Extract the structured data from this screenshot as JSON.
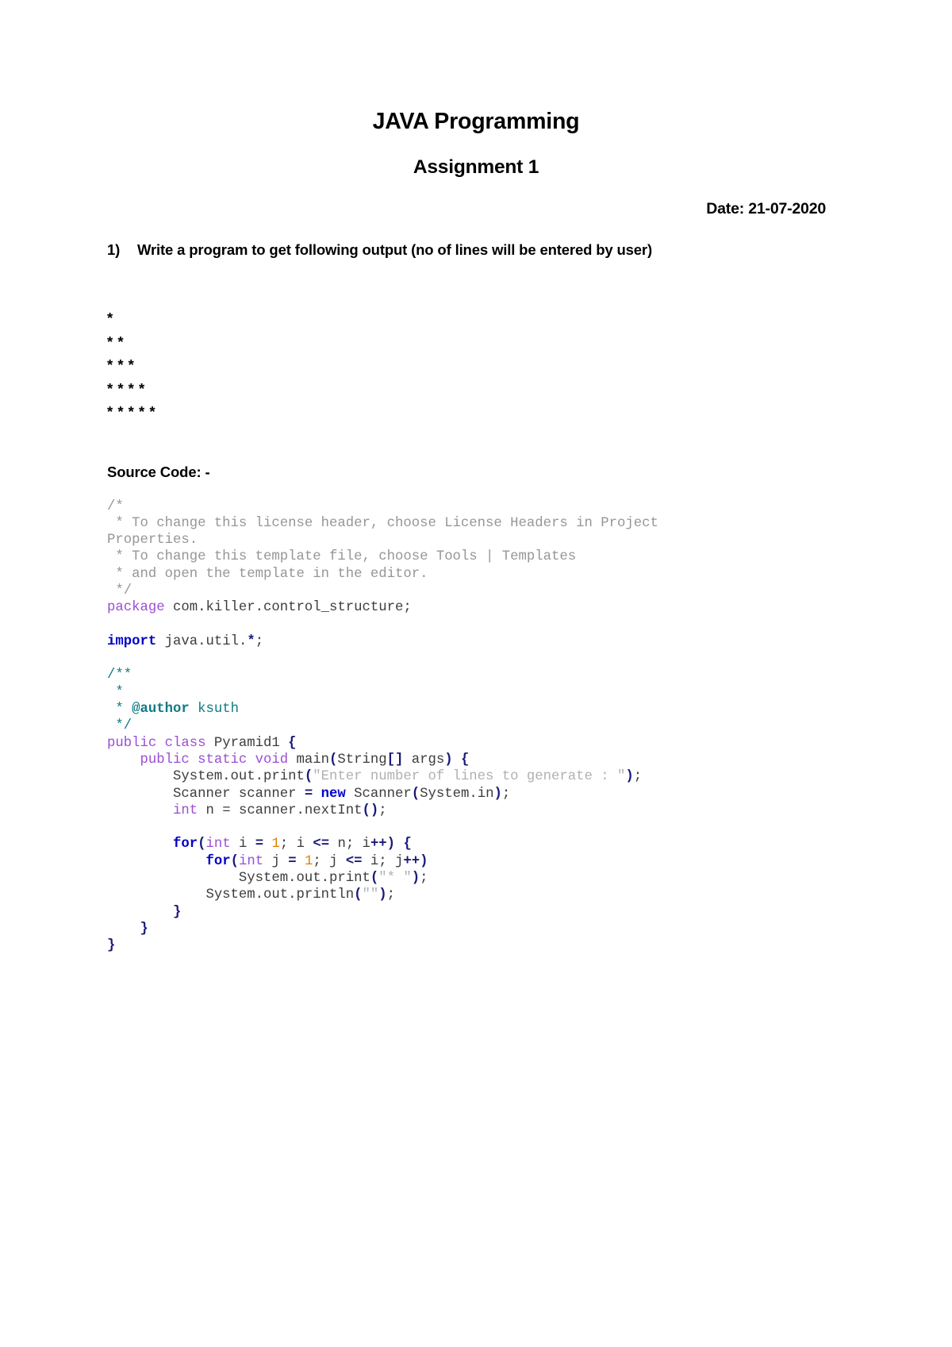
{
  "document": {
    "title": "JAVA Programming",
    "subtitle": "Assignment 1",
    "date_label": "Date: 21-07-2020"
  },
  "question": {
    "number": "1)",
    "text": "Write a program to get following output (no of lines will be entered by user)"
  },
  "pattern_output": {
    "lines": [
      "*",
      "* *",
      "* * *",
      "* * * *",
      "* * * * *"
    ]
  },
  "source_section": {
    "heading": "Source Code: -"
  },
  "code": {
    "language": "java",
    "lines": [
      {
        "tokens": [
          {
            "t": "/*",
            "c": "comment"
          }
        ]
      },
      {
        "tokens": [
          {
            "t": " * To change this license header, choose License Headers in Project",
            "c": "comment"
          }
        ]
      },
      {
        "tokens": [
          {
            "t": "Properties.",
            "c": "comment"
          }
        ]
      },
      {
        "tokens": [
          {
            "t": " * To change this template file, choose Tools | Templates",
            "c": "comment"
          }
        ]
      },
      {
        "tokens": [
          {
            "t": " * and open the template in the editor.",
            "c": "comment"
          }
        ]
      },
      {
        "tokens": [
          {
            "t": " */",
            "c": "comment"
          }
        ]
      },
      {
        "tokens": [
          {
            "t": "package",
            "c": "keyword"
          },
          {
            "t": " com.killer.control_structure;",
            "c": "plain"
          }
        ]
      },
      {
        "tokens": []
      },
      {
        "tokens": [
          {
            "t": "import",
            "c": "kw-blue"
          },
          {
            "t": " java.util.",
            "c": "plain"
          },
          {
            "t": "*",
            "c": "op"
          },
          {
            "t": ";",
            "c": "plain"
          }
        ]
      },
      {
        "tokens": []
      },
      {
        "tokens": [
          {
            "t": "/**",
            "c": "javadoc"
          }
        ]
      },
      {
        "tokens": [
          {
            "t": " *",
            "c": "javadoc"
          }
        ]
      },
      {
        "tokens": [
          {
            "t": " * ",
            "c": "javadoc"
          },
          {
            "t": "@author",
            "c": "javadoc-tag"
          },
          {
            "t": " ksuth",
            "c": "javadoc"
          }
        ]
      },
      {
        "tokens": [
          {
            "t": " */",
            "c": "javadoc"
          }
        ]
      },
      {
        "tokens": [
          {
            "t": "public class",
            "c": "keyword"
          },
          {
            "t": " Pyramid1 ",
            "c": "plain"
          },
          {
            "t": "{",
            "c": "brace"
          }
        ]
      },
      {
        "tokens": [
          {
            "t": "    ",
            "c": "plain"
          },
          {
            "t": "public static void",
            "c": "keyword"
          },
          {
            "t": " main",
            "c": "plain"
          },
          {
            "t": "(",
            "c": "brace"
          },
          {
            "t": "String",
            "c": "plain"
          },
          {
            "t": "[]",
            "c": "brace"
          },
          {
            "t": " args",
            "c": "plain"
          },
          {
            "t": ")",
            "c": "brace"
          },
          {
            "t": " ",
            "c": "plain"
          },
          {
            "t": "{",
            "c": "brace"
          }
        ]
      },
      {
        "tokens": [
          {
            "t": "        System.out.print",
            "c": "plain"
          },
          {
            "t": "(",
            "c": "brace"
          },
          {
            "t": "\"Enter number of lines to generate : \"",
            "c": "string"
          },
          {
            "t": ")",
            "c": "brace"
          },
          {
            "t": ";",
            "c": "plain"
          }
        ]
      },
      {
        "tokens": [
          {
            "t": "        Scanner scanner ",
            "c": "plain"
          },
          {
            "t": "=",
            "c": "op"
          },
          {
            "t": " ",
            "c": "plain"
          },
          {
            "t": "new",
            "c": "kw-blue"
          },
          {
            "t": " Scanner",
            "c": "plain"
          },
          {
            "t": "(",
            "c": "brace"
          },
          {
            "t": "System.in",
            "c": "plain"
          },
          {
            "t": ")",
            "c": "brace"
          },
          {
            "t": ";",
            "c": "plain"
          }
        ]
      },
      {
        "tokens": [
          {
            "t": "        ",
            "c": "plain"
          },
          {
            "t": "int",
            "c": "keyword"
          },
          {
            "t": " n = scanner.nextInt",
            "c": "plain"
          },
          {
            "t": "()",
            "c": "brace"
          },
          {
            "t": ";",
            "c": "plain"
          }
        ]
      },
      {
        "tokens": []
      },
      {
        "tokens": [
          {
            "t": "        ",
            "c": "plain"
          },
          {
            "t": "for",
            "c": "kw-blue"
          },
          {
            "t": "(",
            "c": "brace"
          },
          {
            "t": "int",
            "c": "keyword"
          },
          {
            "t": " i ",
            "c": "plain"
          },
          {
            "t": "=",
            "c": "op"
          },
          {
            "t": " ",
            "c": "plain"
          },
          {
            "t": "1",
            "c": "number"
          },
          {
            "t": "; i ",
            "c": "plain"
          },
          {
            "t": "<=",
            "c": "op"
          },
          {
            "t": " n; i",
            "c": "plain"
          },
          {
            "t": "++)",
            "c": "brace"
          },
          {
            "t": " ",
            "c": "plain"
          },
          {
            "t": "{",
            "c": "brace"
          }
        ]
      },
      {
        "tokens": [
          {
            "t": "            ",
            "c": "plain"
          },
          {
            "t": "for",
            "c": "kw-blue"
          },
          {
            "t": "(",
            "c": "brace"
          },
          {
            "t": "int",
            "c": "keyword"
          },
          {
            "t": " j ",
            "c": "plain"
          },
          {
            "t": "=",
            "c": "op"
          },
          {
            "t": " ",
            "c": "plain"
          },
          {
            "t": "1",
            "c": "number"
          },
          {
            "t": "; j ",
            "c": "plain"
          },
          {
            "t": "<=",
            "c": "op"
          },
          {
            "t": " i; j",
            "c": "plain"
          },
          {
            "t": "++)",
            "c": "brace"
          }
        ]
      },
      {
        "tokens": [
          {
            "t": "                System.out.print",
            "c": "plain"
          },
          {
            "t": "(",
            "c": "brace"
          },
          {
            "t": "\"* \"",
            "c": "string"
          },
          {
            "t": ")",
            "c": "brace"
          },
          {
            "t": ";",
            "c": "plain"
          }
        ]
      },
      {
        "tokens": [
          {
            "t": "            System.out.println",
            "c": "plain"
          },
          {
            "t": "(",
            "c": "brace"
          },
          {
            "t": "\"\"",
            "c": "string"
          },
          {
            "t": ")",
            "c": "brace"
          },
          {
            "t": ";",
            "c": "plain"
          }
        ]
      },
      {
        "tokens": [
          {
            "t": "        ",
            "c": "plain"
          },
          {
            "t": "}",
            "c": "brace"
          }
        ]
      },
      {
        "tokens": [
          {
            "t": "    ",
            "c": "plain"
          },
          {
            "t": "}",
            "c": "brace"
          }
        ]
      },
      {
        "tokens": [
          {
            "t": "}",
            "c": "brace"
          }
        ]
      }
    ]
  },
  "colors": {
    "comment": "#969696",
    "javadoc": "#0f7b84",
    "keyword": "#9a4fd4",
    "keyword_blue": "#0000c8",
    "operator": "#1a1a7a",
    "string": "#b0b0b0",
    "number": "#d98000",
    "plain": "#3d3d3d",
    "page_background": "#ffffff",
    "text": "#000000"
  }
}
